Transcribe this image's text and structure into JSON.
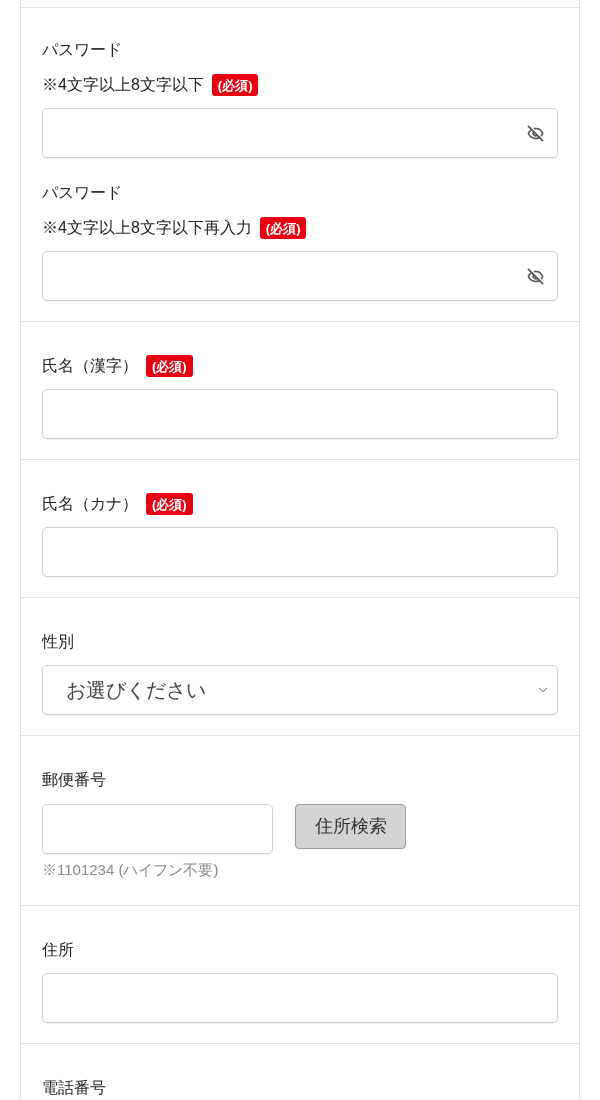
{
  "sections": [
    {
      "items": [
        {
          "kind": "password",
          "label": "パスワード",
          "note": "※4文字以上8文字以下",
          "required_badge": "(必須)"
        },
        {
          "kind": "password",
          "label": "パスワード",
          "note": "※4文字以上8文字以下再入力",
          "required_badge": "(必須)"
        }
      ]
    },
    {
      "items": [
        {
          "kind": "text",
          "label": "氏名（漢字）",
          "required_badge": "(必須)"
        }
      ]
    },
    {
      "items": [
        {
          "kind": "text",
          "label": "氏名（カナ）",
          "required_badge": "(必須)"
        }
      ]
    },
    {
      "items": [
        {
          "kind": "select",
          "label": "性別",
          "value": "お選びください"
        }
      ]
    },
    {
      "items": [
        {
          "kind": "postal",
          "label": "郵便番号",
          "button": "住所検索",
          "hint": "※1101234 (ハイフン不要)"
        }
      ]
    },
    {
      "items": [
        {
          "kind": "text",
          "label": "住所"
        }
      ]
    },
    {
      "items": [
        {
          "kind": "label_only",
          "label": "電話番号"
        }
      ]
    }
  ]
}
